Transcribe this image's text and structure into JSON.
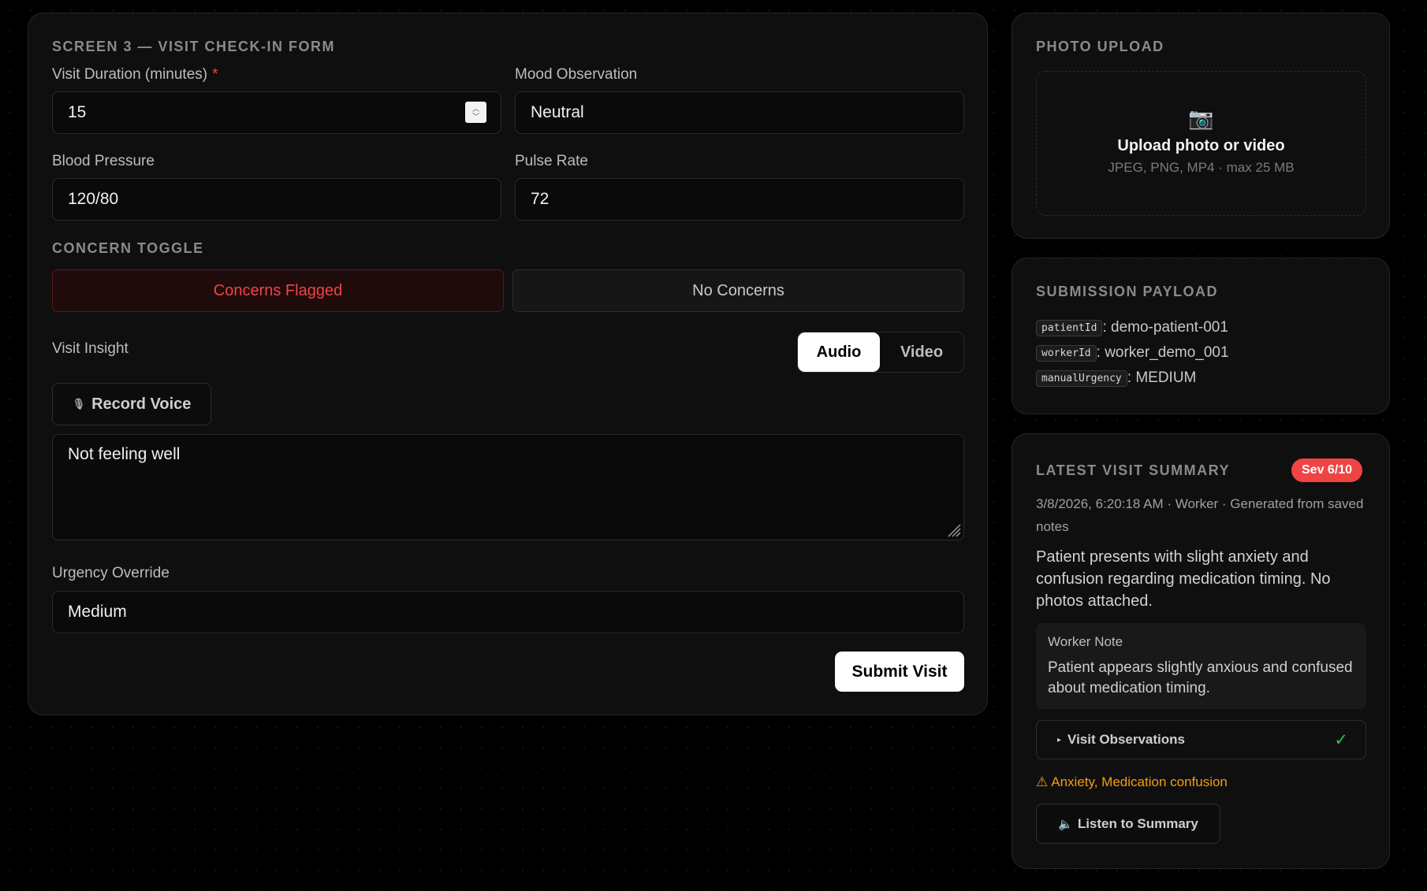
{
  "form": {
    "title": "SCREEN 3 — VISIT CHECK-IN FORM",
    "duration": {
      "label": "Visit Duration (minutes)",
      "required_mark": "*",
      "value": "15"
    },
    "mood": {
      "label": "Mood Observation",
      "value": "Neutral"
    },
    "blood_pressure": {
      "label": "Blood Pressure",
      "value": "120/80"
    },
    "pulse": {
      "label": "Pulse Rate",
      "value": "72"
    },
    "concern": {
      "label": "CONCERN TOGGLE",
      "flagged_label": "Concerns Flagged",
      "none_label": "No Concerns",
      "selected": "Concerns Flagged"
    },
    "insight": {
      "label": "Visit Insight",
      "audio_label": "Audio",
      "video_label": "Video",
      "selected_mode": "Audio",
      "record_label": "Record Voice",
      "note_value": "Not feeling well"
    },
    "urgency": {
      "label": "Urgency Override",
      "value": "Medium"
    },
    "submit_label": "Submit Visit"
  },
  "upload": {
    "title": "PHOTO UPLOAD",
    "camera_glyph": "📷",
    "heading": "Upload photo or video",
    "hint": "JPEG, PNG, MP4 · max 25 MB"
  },
  "payload": {
    "title": "SUBMISSION PAYLOAD",
    "rows": [
      {
        "key": "patientId",
        "value": "demo-patient-001"
      },
      {
        "key": "workerId",
        "value": "worker_demo_001"
      },
      {
        "key": "manualUrgency",
        "value": "MEDIUM"
      }
    ]
  },
  "summary": {
    "title": "LATEST VISIT SUMMARY",
    "severity_badge": "Sev 6/10",
    "meta": "3/8/2026, 6:20:18 AM · Worker · Generated from saved notes",
    "text": "Patient presents with slight anxiety and confusion regarding medication timing. No photos attached.",
    "worker_note_label": "Worker Note",
    "worker_note_text": "Patient appears slightly anxious and confused about medication timing.",
    "observations_label": "Visit Observations",
    "observations_check": "✓",
    "warning_glyph": "⚠",
    "warning_text": "Anxiety, Medication confusion",
    "listen_label": "Listen to Summary"
  },
  "colors": {
    "danger": "#ef4444",
    "warning": "#f59e0b",
    "success": "#22c55e"
  }
}
